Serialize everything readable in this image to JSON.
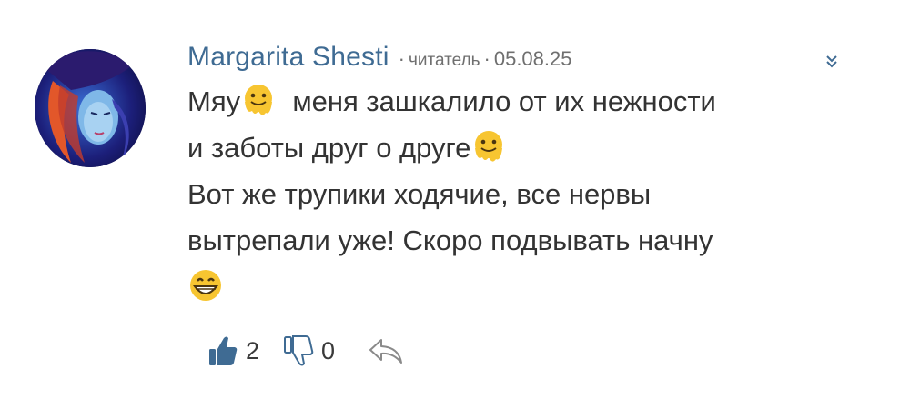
{
  "comment": {
    "author": "Margarita Shesti",
    "role": "читатель",
    "date": "05.08.25",
    "separator": "·",
    "text": {
      "l1a": "Мяу",
      "l1b": "меня зашкалило от их нежности",
      "l2": "и заботы друг о друге",
      "l3": "Вот же трупики ходячие,  все нервы",
      "l4": "вытрепали уже! Скоро подвывать начну"
    },
    "emojis": [
      "melting-face",
      "melting-face",
      "grinning-face"
    ]
  },
  "actions": {
    "likes": "2",
    "dislikes": "0"
  },
  "icons": {
    "like": "thumb-up-icon",
    "dislike": "thumb-down-icon",
    "reply": "reply-icon",
    "collapse": "chevron-double-down-icon"
  },
  "colors": {
    "author": "#3f6b93",
    "text": "#333333",
    "meta": "#6f6f6f",
    "like": "#3f6b93"
  }
}
